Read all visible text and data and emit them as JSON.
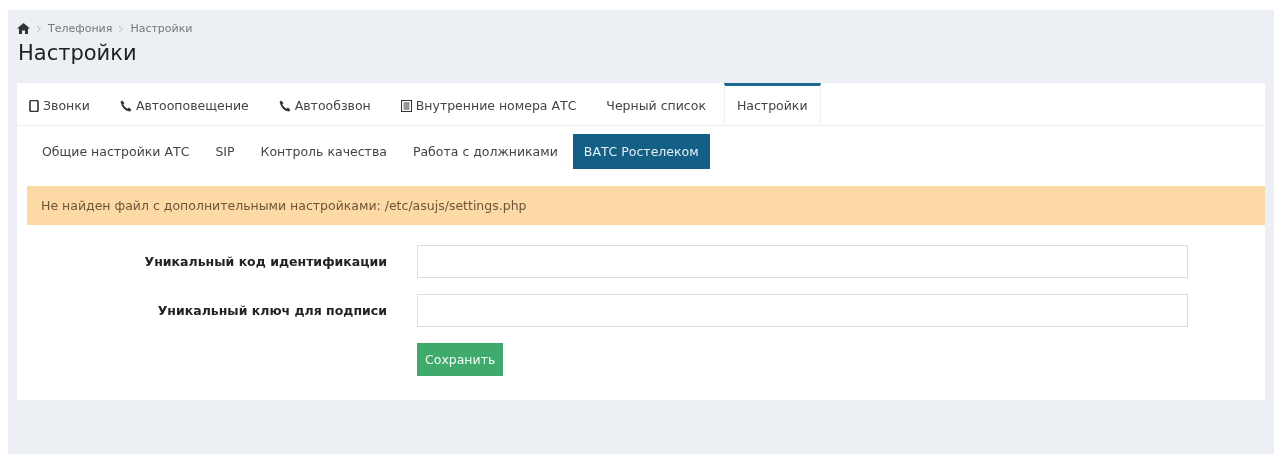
{
  "breadcrumb": [
    "Телефония",
    "Настройки"
  ],
  "title": "Настройки",
  "tabs": [
    {
      "label": "Звонки",
      "kind": "mobile",
      "selected": false
    },
    {
      "label": "Автооповещение",
      "kind": "phone",
      "selected": false
    },
    {
      "label": "Автообзвон",
      "kind": "phone",
      "selected": false
    },
    {
      "label": "Внутренние номера АТС",
      "kind": "book",
      "selected": false
    },
    {
      "label": "Черный список",
      "kind": "plain",
      "selected": false
    },
    {
      "label": "Настройки",
      "kind": "plain",
      "selected": true
    }
  ],
  "subtabs": [
    {
      "label": "Общие настройки АТС",
      "selected": false
    },
    {
      "label": "SIP",
      "selected": false
    },
    {
      "label": "Контроль качества",
      "selected": false
    },
    {
      "label": "Работа с должниками",
      "selected": false
    },
    {
      "label": "ВАТС Ростелеком",
      "selected": true
    }
  ],
  "alert": "Не найден файл с дополнительными настройками: /etc/asujs/settings.php",
  "fields": [
    {
      "label": "Уникальный код идентификации"
    },
    {
      "label": "Уникальный ключ для подписи"
    }
  ],
  "save_button": "Сохранить"
}
